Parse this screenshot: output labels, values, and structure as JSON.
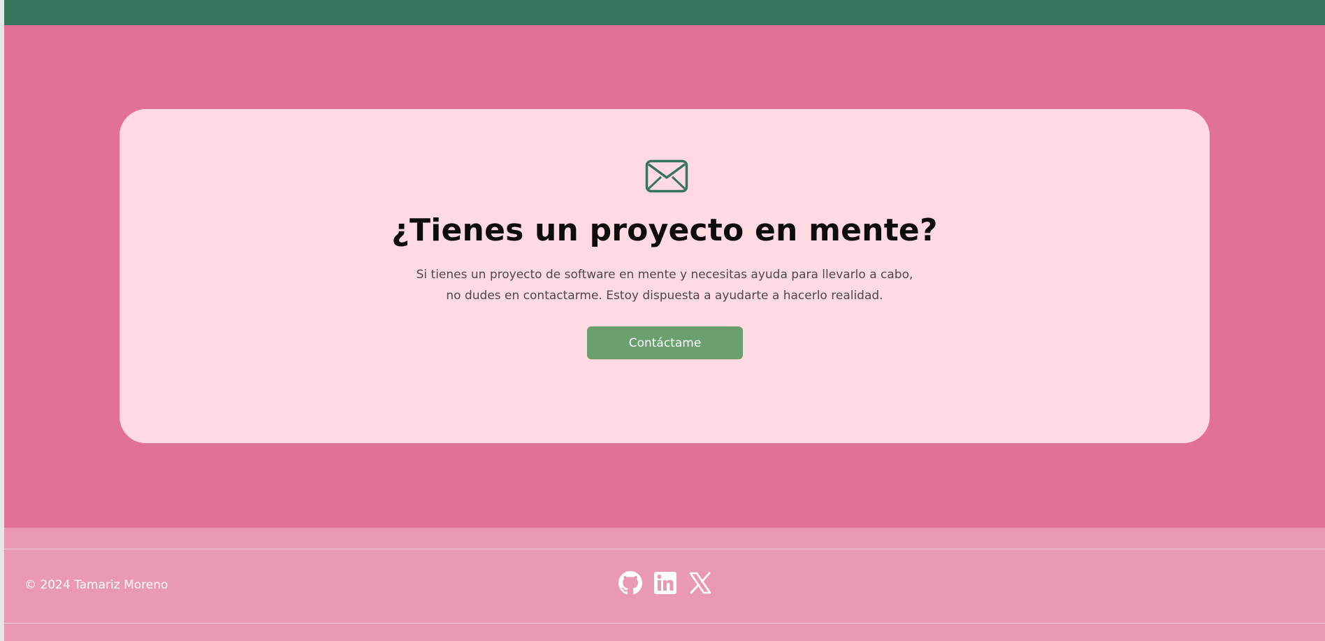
{
  "contact_card": {
    "icon": "mail-icon",
    "title": "¿Tienes un proyecto en mente?",
    "description": "Si tienes un proyecto de software en mente y necesitas ayuda para llevarlo a cabo, no dudes en contactarme. Estoy dispuesta a ayudarte a hacerlo realidad.",
    "button_label": "Contáctame"
  },
  "footer": {
    "copyright": "© 2024 Tamariz Moreno",
    "social": [
      {
        "icon": "github-icon"
      },
      {
        "icon": "linkedin-icon"
      },
      {
        "icon": "x-icon"
      }
    ]
  },
  "colors": {
    "top_bar": "#35755b",
    "hero_background": "#e27295",
    "card_background": "#ffdae3",
    "button": "#6aa06f",
    "footer_background": "#e999b2"
  }
}
